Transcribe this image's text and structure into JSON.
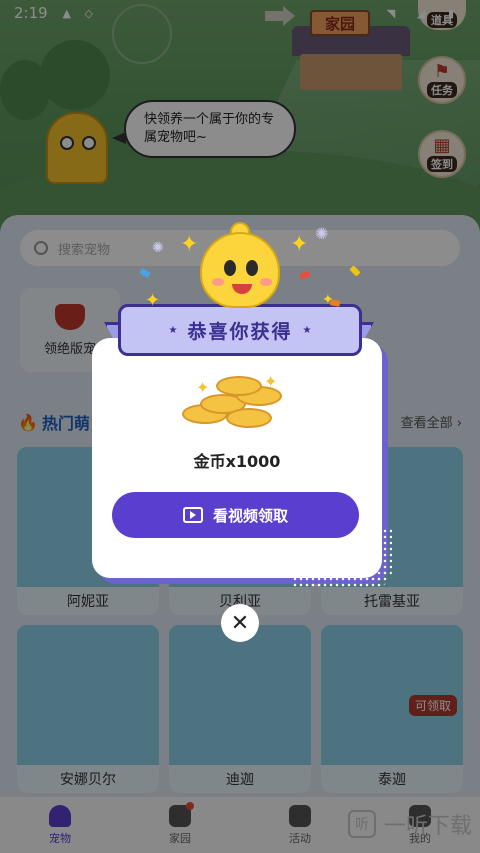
{
  "status_bar": {
    "time": "2:19"
  },
  "scene": {
    "house_sign": "家园",
    "side_buttons": [
      {
        "label": "道具",
        "icon": "props-icon"
      },
      {
        "label": "任务",
        "icon": "flag-icon"
      },
      {
        "label": "签到",
        "icon": "calendar-icon"
      }
    ],
    "bubble_text": "快领养一个属于你的专属宠物吧~"
  },
  "main": {
    "search_placeholder": "搜索宠物",
    "categories": [
      {
        "label": "领绝版宠"
      }
    ],
    "hot_title": "热门萌",
    "see_all": "查看全部 ›",
    "pets": [
      {
        "name": "阿妮亚",
        "color": "#8fd1ea"
      },
      {
        "name": "贝利亚",
        "color": "#8fd1ea"
      },
      {
        "name": "托雷基亚",
        "color": "#8fd1ea"
      },
      {
        "name": "安娜贝尔",
        "color": "#8fd1ea"
      },
      {
        "name": "迪迦",
        "color": "#8fd1ea"
      },
      {
        "name": "泰迦",
        "color": "#8fd1ea",
        "badge": "可领取"
      }
    ]
  },
  "tabs": [
    {
      "label": "宠物",
      "active": true
    },
    {
      "label": "家园",
      "active": false,
      "dot": true
    },
    {
      "label": "活动",
      "active": false
    },
    {
      "label": "我的",
      "active": false
    }
  ],
  "watermark": "一听下载",
  "watermark_icon": "听",
  "dialog": {
    "title": "恭喜你获得",
    "reward": "金币x1000",
    "button_label": "看视频领取",
    "close_symbol": "✕",
    "accent_color": "#5a3fcf",
    "ribbon_color": "#c3c4f3"
  }
}
